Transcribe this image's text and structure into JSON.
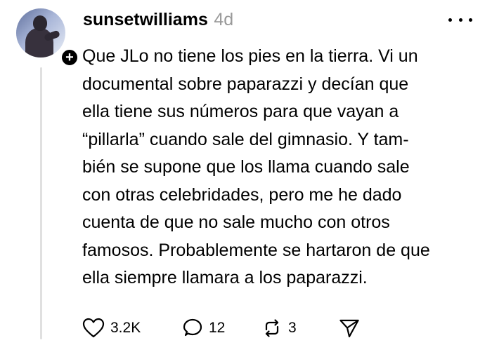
{
  "post": {
    "username": "sunsetwilliams",
    "timestamp": "4d",
    "body_lines": [
      "Que JLo no tiene los pies en la tierra. Vi un",
      "documental sobre paparazzi y decían que",
      "ella tiene sus números para que vayan a",
      "“pillarla” cuando sale del gimnasio. Y tam-",
      "bién se supone que los llama cuando sale",
      "con otras celebridades, pero me he dado",
      "cuenta de que no sale mucho con otros",
      "famosos. Probablemente se hartaron de que",
      "ella siempre llamara a los paparazzi."
    ],
    "follow_badge": "+"
  },
  "actions": {
    "like": {
      "icon": "heart-icon",
      "count": "3.2K"
    },
    "reply": {
      "icon": "speech-bubble-icon",
      "count": "12"
    },
    "repost": {
      "icon": "repost-icon",
      "count": "3"
    },
    "share": {
      "icon": "send-icon"
    }
  },
  "colors": {
    "text": "#000000",
    "muted": "#999999",
    "thread_line": "#e0e0e0",
    "background": "#ffffff"
  }
}
